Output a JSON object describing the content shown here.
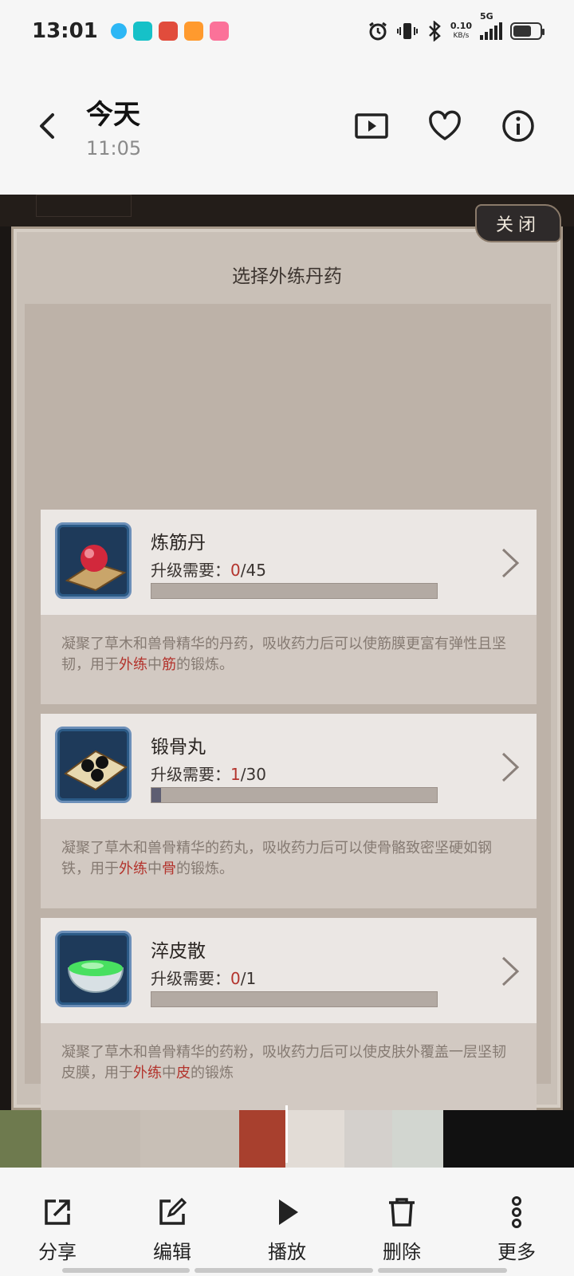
{
  "status_bar": {
    "time": "13:01",
    "net_speed": "0.10",
    "net_unit": "KB/s",
    "network": "5G",
    "app_icons": [
      "qq-icon",
      "taptap-icon",
      "game-icon",
      "video-icon",
      "bilibili-icon"
    ],
    "status_icons": [
      "alarm-icon",
      "vibrate-icon",
      "bluetooth-icon",
      "signal-icon",
      "battery-icon"
    ]
  },
  "header": {
    "title": "今天",
    "subtitle": "11:05"
  },
  "panel": {
    "close_label": "关闭",
    "title": "选择外练丹药",
    "items": [
      {
        "name": "炼筋丹",
        "req_label": "升级需要：",
        "req_current": "0",
        "req_total": "/45",
        "progress": 0,
        "desc_prefix": "凝聚了草木和兽骨精华的丹药，吸收药力后可以使筋膜更富有弹性且坚韧，用于",
        "desc_hl1": "外练",
        "desc_mid": "中",
        "desc_hl2": "筋",
        "desc_suffix": "的锻炼。"
      },
      {
        "name": "锻骨丸",
        "req_label": "升级需要：",
        "req_current": "1",
        "req_total": "/30",
        "progress": 0.033,
        "desc_prefix": "凝聚了草木和兽骨精华的药丸，吸收药力后可以使骨骼致密坚硬如钢铁，用于",
        "desc_hl1": "外练",
        "desc_mid": "中",
        "desc_hl2": "骨",
        "desc_suffix": "的锻炼。"
      },
      {
        "name": "淬皮散",
        "req_label": "升级需要：",
        "req_current": "0",
        "req_total": "/1",
        "progress": 0,
        "desc_prefix": "凝聚了草木和兽骨精华的药粉，吸收药力后可以使皮肤外覆盖一层坚韧皮膜，用于",
        "desc_hl1": "外练",
        "desc_mid": "中",
        "desc_hl2": "皮",
        "desc_suffix": "的锻炼"
      }
    ]
  },
  "toolbar": {
    "share": "分享",
    "edit": "编辑",
    "play": "播放",
    "delete": "删除",
    "more": "更多"
  },
  "colors": {
    "accent_red": "#b3342d",
    "panel_bg": "#c9c0b7"
  }
}
